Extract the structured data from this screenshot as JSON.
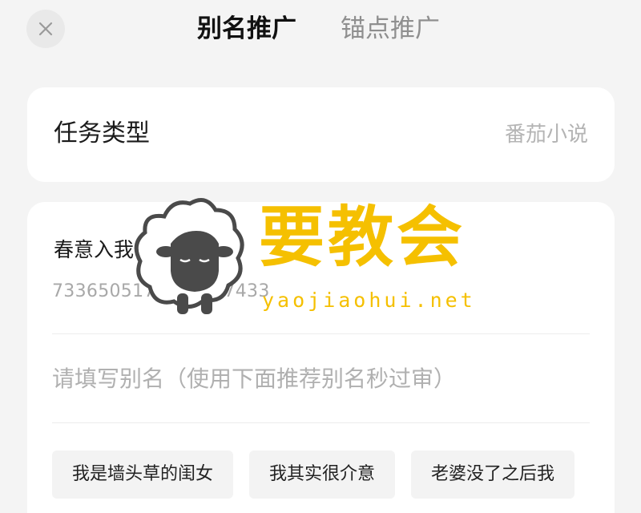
{
  "header": {
    "tabs": [
      {
        "label": "别名推广",
        "active": true
      },
      {
        "label": "锚点推广",
        "active": false
      }
    ],
    "close_icon": "close-icon"
  },
  "task": {
    "label": "任务类型",
    "value": "番茄小说"
  },
  "book": {
    "title": "春意入我怀",
    "id": "7336505171825937433"
  },
  "alias": {
    "placeholder": "请填写别名（使用下面推荐别名秒过审）",
    "value": ""
  },
  "suggestions": [
    "我是墙头草的闺女",
    "我其实很介意",
    "老婆没了之后我"
  ],
  "watermark": {
    "title": "要教会",
    "url": "yaojiaohui.net",
    "color": "#f5c000"
  },
  "colors": {
    "background": "#f4f4f4",
    "card": "#ffffff",
    "active_tab": "#111111",
    "inactive_tab": "#8f8f8f"
  }
}
